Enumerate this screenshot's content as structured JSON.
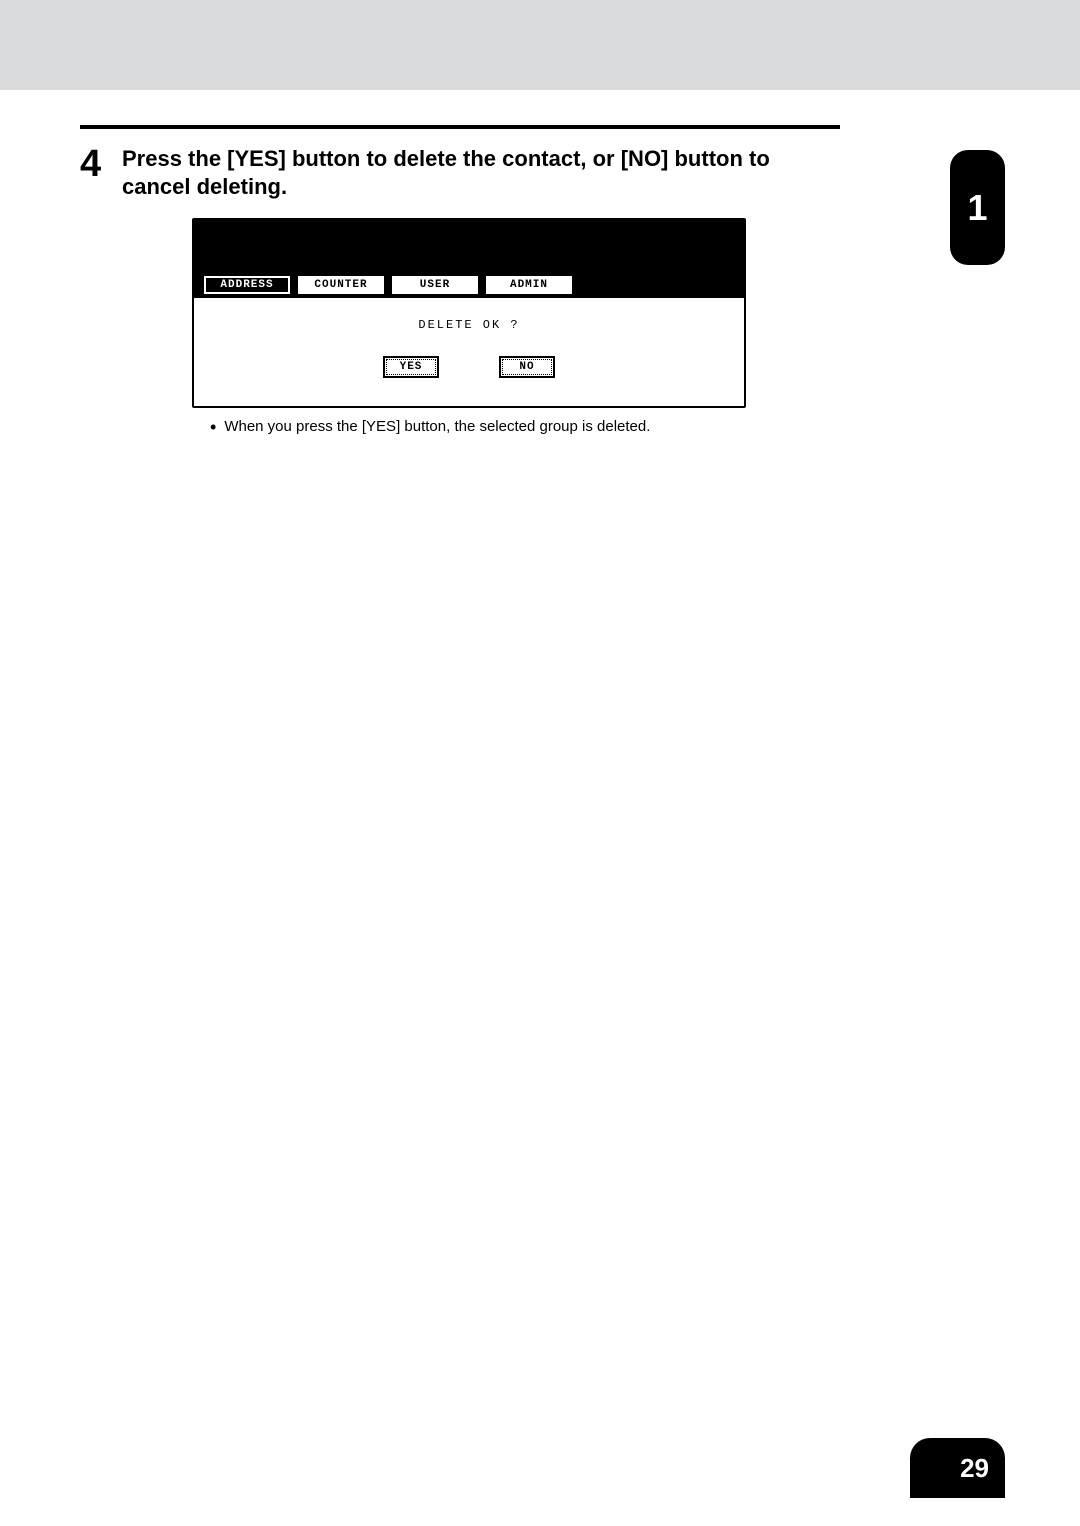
{
  "step": {
    "number": "4",
    "text": "Press the [YES] button to delete the contact, or [NO] button to cancel deleting."
  },
  "lcd": {
    "tabs": {
      "address": "ADDRESS",
      "counter": "COUNTER",
      "user": "USER",
      "admin": "ADMIN"
    },
    "prompt": "DELETE OK ?",
    "yes": "YES",
    "no": "NO"
  },
  "bullet": "When you press the [YES] button, the selected group is deleted.",
  "chapter": "1",
  "page_number": "29"
}
